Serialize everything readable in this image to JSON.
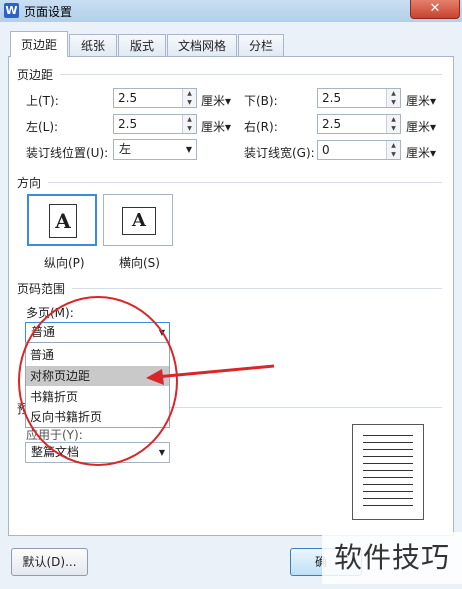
{
  "window": {
    "title": "页面设置",
    "app_icon": "W",
    "close": "✕"
  },
  "tabs": [
    {
      "label": "页边距",
      "active": true
    },
    {
      "label": "纸张"
    },
    {
      "label": "版式"
    },
    {
      "label": "文档网格"
    },
    {
      "label": "分栏"
    }
  ],
  "margins": {
    "section_title": "页边距",
    "top": {
      "label": "上(T):",
      "value": "2.5",
      "unit": "厘米"
    },
    "bottom": {
      "label": "下(B):",
      "value": "2.5",
      "unit": "厘米"
    },
    "left": {
      "label": "左(L):",
      "value": "2.5",
      "unit": "厘米"
    },
    "right": {
      "label": "右(R):",
      "value": "2.5",
      "unit": "厘米"
    },
    "gutter_position": {
      "label": "装订线位置(U):",
      "value": "左"
    },
    "gutter_width": {
      "label": "装订线宽(G):",
      "value": "0",
      "unit": "厘米"
    }
  },
  "orientation": {
    "section_title": "方向",
    "portrait": {
      "label": "纵向(P)",
      "glyph": "A",
      "selected": true
    },
    "landscape": {
      "label": "横向(S)",
      "glyph": "A"
    }
  },
  "page_range": {
    "section_title": "页码范围",
    "multiple_label": "多页(M):",
    "multiple_value": "普通",
    "options": [
      "普通",
      "对称页边距",
      "书籍折页",
      "反向书籍折页"
    ],
    "highlighted_option": "对称页边距"
  },
  "preview": {
    "section_title_partial": "预",
    "apply_label_partial": "应用于(Y):",
    "apply_value": "整篇文档"
  },
  "buttons": {
    "default": "默认(D)...",
    "ok_partial": "确"
  },
  "watermark": "软件技巧",
  "colors": {
    "annotation_red": "#d8262a",
    "selection_blue": "#3b8be0"
  }
}
